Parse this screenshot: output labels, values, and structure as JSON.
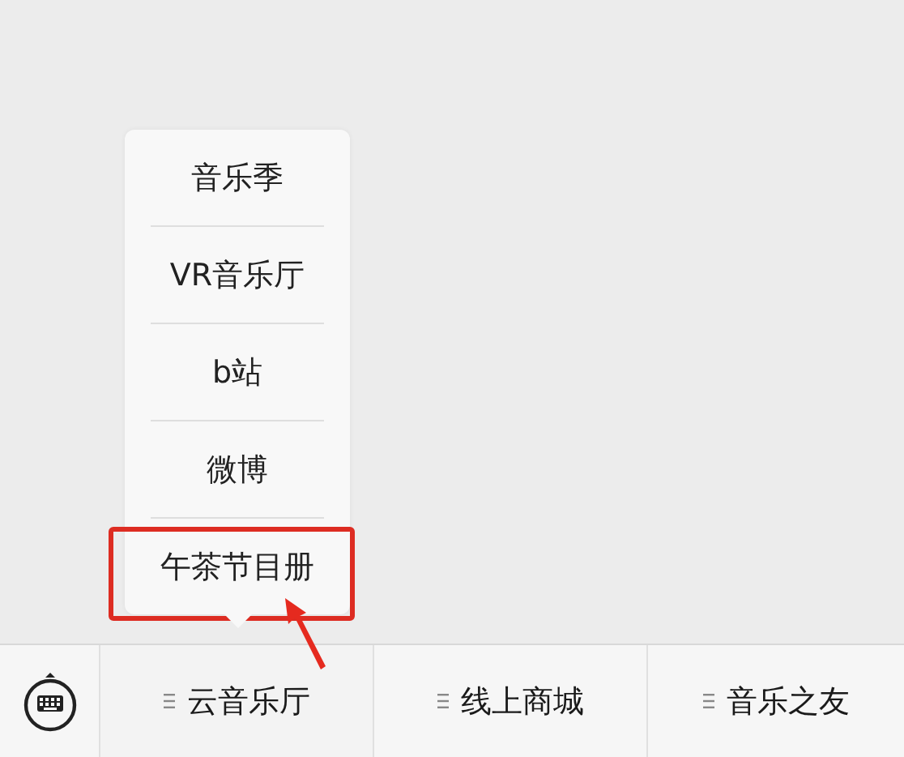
{
  "submenu": {
    "items": [
      {
        "label": "音乐季",
        "highlighted": false
      },
      {
        "label": "VR音乐厅",
        "highlighted": false
      },
      {
        "label": "b站",
        "highlighted": false
      },
      {
        "label": "微博",
        "highlighted": false
      },
      {
        "label": "午茶节目册",
        "highlighted": true
      }
    ]
  },
  "menu_bar": {
    "menus": [
      {
        "label": "云音乐厅",
        "expanded": true
      },
      {
        "label": "线上商城",
        "expanded": false
      },
      {
        "label": "音乐之友",
        "expanded": false
      }
    ]
  }
}
